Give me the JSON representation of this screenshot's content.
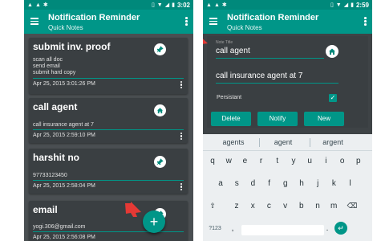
{
  "colors": {
    "accent": "#009688",
    "status_bar": "#00897b",
    "arrow": "#e53935",
    "card": "#3a3f42"
  },
  "left_screen": {
    "status": {
      "time": "3:02",
      "left_icons": [
        "notification-icon",
        "notification-icon",
        "bug-icon"
      ],
      "right_icons": [
        "vibrate-icon",
        "wifi-icon",
        "signal-icon",
        "battery-icon"
      ]
    },
    "app_title": "Notification Reminder",
    "app_subtitle": "Quick Notes",
    "notes": [
      {
        "title": "submit inv. proof",
        "lines": [
          "scan all doc",
          "send email",
          "submit hard copy"
        ],
        "date": "Apr 25, 2015 3:01:26 PM",
        "icon": "pin-icon"
      },
      {
        "title": "call agent",
        "lines": [
          "call insurance agent at 7"
        ],
        "date": "Apr 25, 2015 2:59:10 PM",
        "icon": "home-icon"
      },
      {
        "title": "harshit no",
        "lines": [
          "97733123450"
        ],
        "date": "Apr 25, 2015 2:58:04 PM",
        "icon": "pin-icon"
      },
      {
        "title": "email",
        "lines": [
          "yogi.306@gmail.com"
        ],
        "date": "Apr 25, 2015 2:56:08 PM",
        "icon": "pin-icon"
      }
    ],
    "fab_label": "+"
  },
  "right_screen": {
    "status": {
      "time": "2:59",
      "left_icons": [
        "notification-icon",
        "notification-icon",
        "bug-icon"
      ],
      "right_icons": [
        "vibrate-icon",
        "wifi-icon",
        "signal-icon",
        "battery-icon"
      ]
    },
    "app_title": "Notification Reminder",
    "app_subtitle": "Quick Notes",
    "note_title_label": "Note Title",
    "note_title_value": "call agent",
    "note_body_value": "call insurance agent at 7",
    "persistent_label": "Persistant",
    "persistent_checked": true,
    "buttons": {
      "delete": "Delete",
      "notify": "Notify",
      "new": "New"
    },
    "suggestions": [
      "agents",
      "agent",
      "argent"
    ],
    "keyboard_rows": [
      [
        "q",
        "w",
        "e",
        "r",
        "t",
        "y",
        "u",
        "i",
        "o",
        "p"
      ],
      [
        "a",
        "s",
        "d",
        "f",
        "g",
        "h",
        "j",
        "k",
        "l"
      ],
      [
        "z",
        "x",
        "c",
        "v",
        "b",
        "n",
        "m"
      ]
    ],
    "keyboard_fn": {
      "symbols": "?123",
      "comma": ",",
      "period": "."
    }
  }
}
